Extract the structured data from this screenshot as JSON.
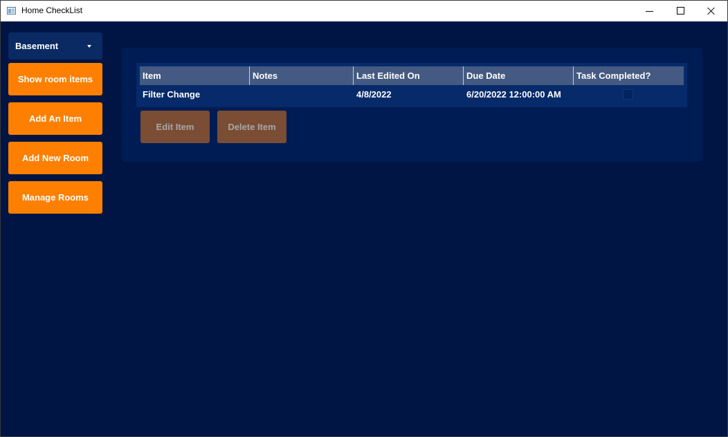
{
  "window": {
    "title": "Home CheckList",
    "icon": "app-window-icon",
    "controls": [
      "minimize-icon",
      "maximize-icon",
      "close-icon"
    ]
  },
  "sidebar": {
    "room_select": {
      "selected": "Basement",
      "icon": "chevron-down-icon"
    },
    "buttons": {
      "show_room_items": "Show room items",
      "add_item": "Add An Item",
      "add_room": "Add New Room",
      "manage_rooms": "Manage Rooms"
    }
  },
  "table": {
    "columns": [
      "Item",
      "Notes",
      "Last Edited On",
      "Due Date",
      "Task Completed?"
    ],
    "rows": [
      {
        "item": "Filter Change",
        "notes": "",
        "last_edited": "4/8/2022",
        "due_date": "6/20/2022 12:00:00 AM",
        "completed": false
      }
    ]
  },
  "actions": {
    "edit_label": "Edit Item",
    "delete_label": "Delete Item",
    "enabled": false
  },
  "colors": {
    "background": "#001544",
    "panel": "#001c55",
    "accent": "#ff8000",
    "disabled_button": "#7a4d34",
    "header": "#445a82"
  }
}
